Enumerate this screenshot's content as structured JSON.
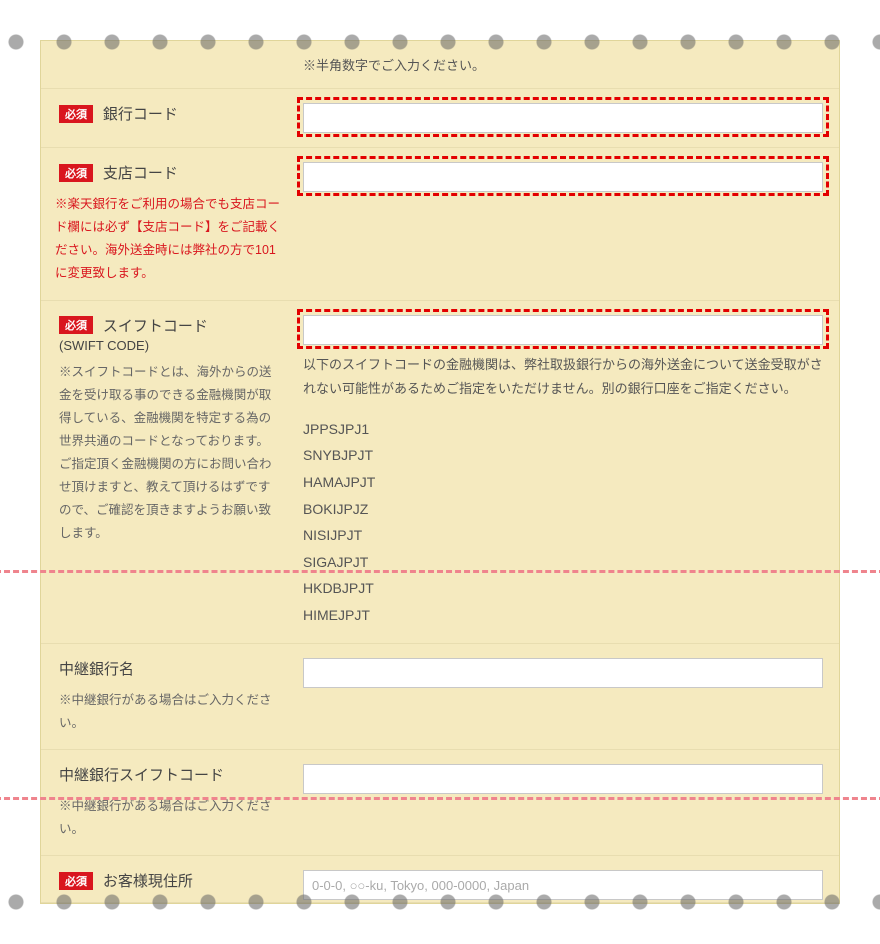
{
  "required_label": "必須",
  "hanbyou_note": "※半角数字でご入力ください。",
  "rows": {
    "bank_code": {
      "label": "銀行コード"
    },
    "branch_code": {
      "label": "支店コード",
      "help": "※楽天銀行をご利用の場合でも支店コード欄には必ず【支店コード】をご記載ください。海外送金時には弊社の方で101に変更致します。"
    },
    "swift": {
      "label": "スイフトコード",
      "sub_label": "(SWIFT CODE)",
      "help": "※スイフトコードとは、海外からの送金を受け取る事のできる金融機関が取得している、金融機関を特定する為の世界共通のコードとなっております。ご指定頂く金融機関の方にお問い合わせ頂けますと、教えて頂けるはずですので、ご確認を頂きますようお願い致します。",
      "note": "以下のスイフトコードの金融機関は、弊社取扱銀行からの海外送金について送金受取がされない可能性があるためご指定をいただけません。別の銀行口座をご指定ください。",
      "codes": [
        "JPPSJPJ1",
        "SNYBJPJT",
        "HAMAJPJT",
        "BOKIJPJZ",
        "NISIJPJT",
        "SIGAJPJT",
        "HKDBJPJT",
        "HIMEJPJT"
      ]
    },
    "relay_bank_name": {
      "label": "中継銀行名",
      "help": "※中継銀行がある場合はご入力ください。"
    },
    "relay_bank_swift": {
      "label": "中継銀行スイフトコード",
      "help": "※中継銀行がある場合はご入力ください。"
    },
    "address": {
      "label": "お客様現住所",
      "placeholder": "0-0-0, ○○-ku, Tokyo, 000-0000, Japan"
    }
  }
}
